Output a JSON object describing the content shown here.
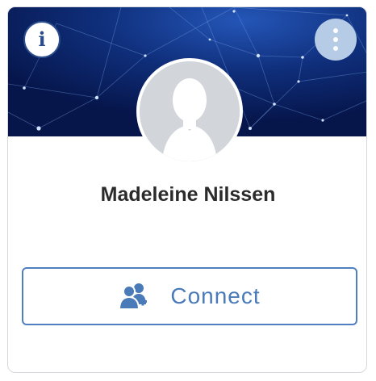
{
  "profile": {
    "name": "Madeleine Nilssen"
  },
  "actions": {
    "connect_label": "Connect"
  },
  "icons": {
    "info": "info-icon",
    "more": "more-vertical-icon",
    "avatar": "person-silhouette-icon",
    "connect": "add-user-icon"
  },
  "colors": {
    "banner": "#0a1f5c",
    "accent": "#4f7fc0",
    "avatar_bg": "#d2d6db",
    "more_button": "#b6cbe6"
  }
}
